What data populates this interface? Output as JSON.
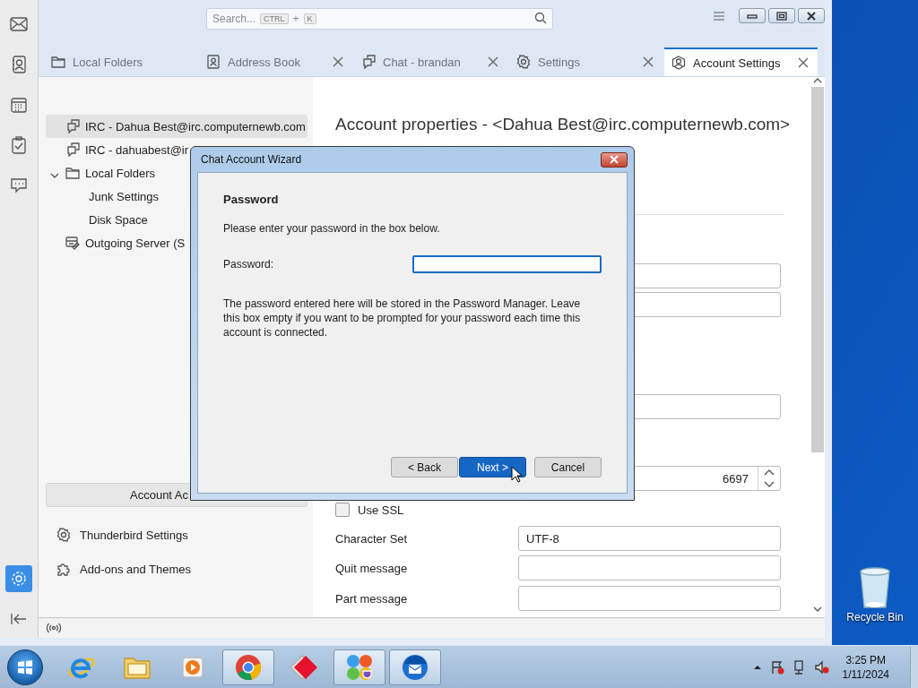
{
  "spaces_bar": {
    "buttons": [
      {
        "kind": "mail",
        "selected": false
      },
      {
        "kind": "address-book",
        "selected": false
      },
      {
        "kind": "calendar",
        "selected": false
      },
      {
        "kind": "tasks",
        "selected": false
      },
      {
        "kind": "chat",
        "selected": false
      },
      {
        "kind": "settings",
        "selected": true
      },
      {
        "kind": "collapse",
        "selected": false
      }
    ]
  },
  "toolbar": {
    "search": {
      "placeholder": "Search...",
      "keys": [
        "CTRL",
        "K"
      ],
      "joiner": "+"
    }
  },
  "tabs": [
    {
      "label": "Local Folders",
      "kind": "folder",
      "closable": false,
      "selected": false
    },
    {
      "label": "Address Book",
      "kind": "address-book",
      "closable": true,
      "selected": false
    },
    {
      "label": "Chat - brandan",
      "kind": "chat",
      "closable": true,
      "selected": false
    },
    {
      "label": "Settings",
      "kind": "gear",
      "closable": true,
      "selected": false
    },
    {
      "label": "Account Settings",
      "kind": "account",
      "closable": true,
      "selected": true
    }
  ],
  "sidebar": {
    "accounts": [
      {
        "label": "IRC - Dahua Best@irc.computernewb.com",
        "kind": "chat",
        "selected": true
      },
      {
        "label": "IRC - dahuabest@ir",
        "kind": "chat",
        "selected": false
      },
      {
        "label": "Local Folders",
        "kind": "folder",
        "selected": false,
        "expanded": true,
        "children": [
          {
            "label": "Junk Settings",
            "selected": false
          },
          {
            "label": "Disk Space",
            "selected": false
          }
        ]
      },
      {
        "label": "Outgoing Server (S",
        "kind": "server",
        "selected": false
      }
    ],
    "account_actions": "Account Ac",
    "links": [
      {
        "label": "Thunderbird Settings",
        "kind": "gear"
      },
      {
        "label": "Add-ons and Themes",
        "kind": "puzzle"
      }
    ]
  },
  "content": {
    "heading": "Account properties - <Dahua Best@irc.computernewb.com>",
    "rows": [
      {
        "kind": "text"
      },
      {
        "kind": "text"
      },
      {
        "kind": "text"
      },
      {
        "kind": "number",
        "value": "6697"
      },
      {
        "kind": "checkbox",
        "label": "Use SSL",
        "checked": false
      },
      {
        "kind": "text",
        "label": "Character Set",
        "value": "UTF-8"
      },
      {
        "kind": "text",
        "label": "Quit message"
      },
      {
        "kind": "text",
        "label": "Part message"
      }
    ]
  },
  "dialog": {
    "title": "Chat Account Wizard",
    "heading": "Password",
    "intro": "Please enter your password in the box below.",
    "field_label": "Password:",
    "field_focused": true,
    "note": "The password entered here will be stored in the Password Manager. Leave this box empty if you want to be prompted for your password each time this account is connected.",
    "buttons": [
      {
        "label": "< Back",
        "default": false
      },
      {
        "label": "Next >",
        "default": true
      },
      {
        "label": "Cancel",
        "default": false
      }
    ]
  },
  "desktop": {
    "icons": [
      {
        "label": "Recycle Bin"
      }
    ]
  },
  "taskbar": {
    "apps": [
      {
        "kind": "ie",
        "active": false
      },
      {
        "kind": "explorer",
        "active": false
      },
      {
        "kind": "media",
        "active": false
      },
      {
        "kind": "chrome",
        "active": true
      },
      {
        "kind": "diamond",
        "active": false
      },
      {
        "kind": "tiles",
        "active": true
      },
      {
        "kind": "thunderbird",
        "active": true
      }
    ],
    "time": "3:25 PM",
    "date": "1/11/2024"
  }
}
